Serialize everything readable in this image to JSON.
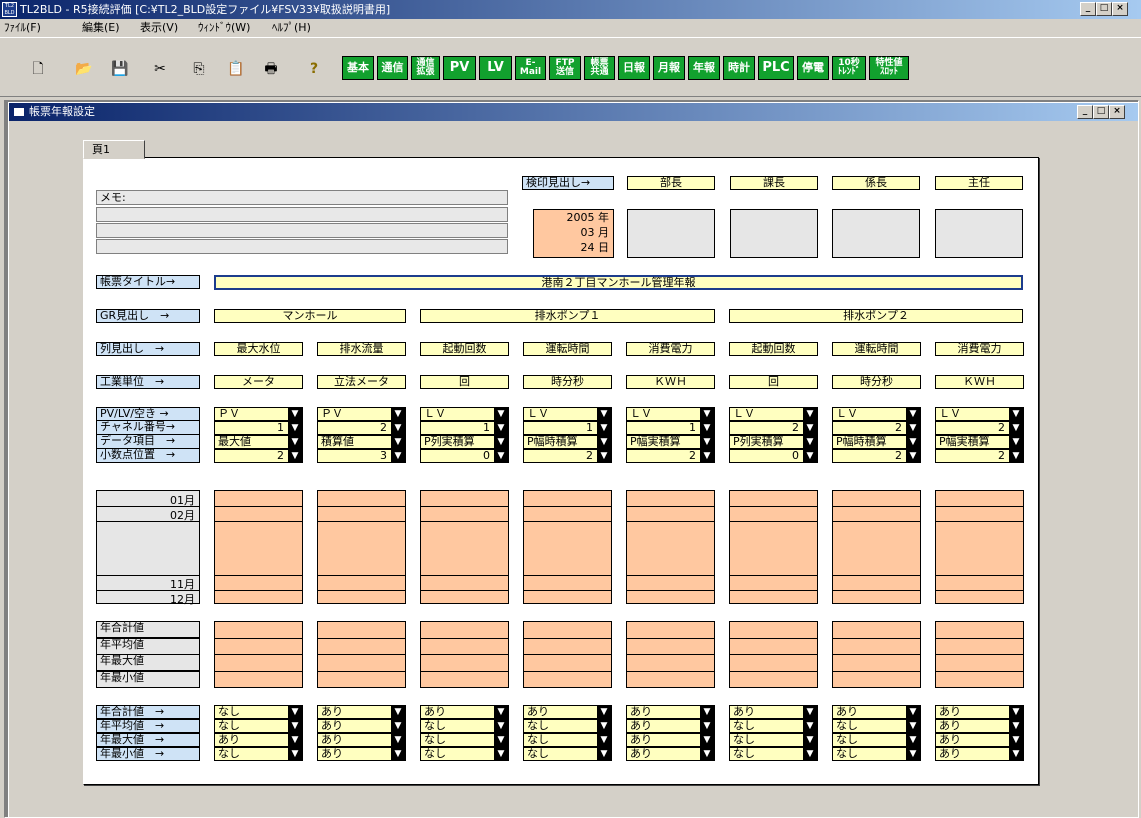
{
  "window": {
    "title": "TL2BLD - R5接続評価 [C:¥TL2_BLD設定ファイル¥FSV33¥取扱説明書用]",
    "app_icon": "TL2 BLD"
  },
  "menu": [
    "ﾌｧｲﾙ(F)",
    "編集(E)",
    "表示(V)",
    "ｳｨﾝﾄﾞｳ(W)",
    "ﾍﾙﾌﾟ(H)"
  ],
  "toolbar": {
    "icons": [
      "new-file-icon",
      "open-folder-icon",
      "save-icon",
      "cut-icon",
      "copy-icon",
      "paste-icon",
      "print-icon",
      "help-icon"
    ],
    "icon_glyphs": [
      "🗋",
      "📂",
      "💾",
      "✂",
      "⎘",
      "📋",
      "🖶",
      "?"
    ],
    "buttons": [
      "基本",
      "通信",
      "通信\n拡張",
      "PV",
      "LV",
      "E-\nMail",
      "FTP\n送信",
      "帳票\n共通",
      "日報",
      "月報",
      "年報",
      "時計",
      "PLC",
      "停電",
      "10秒\nﾄﾚﾝﾄﾞ",
      "特性値\nｽﾛｯﾄ"
    ]
  },
  "child": {
    "title": "帳票年報設定",
    "tab": "頁1"
  },
  "stamp": {
    "label": "検印見出し→",
    "titles": [
      "部長",
      "課長",
      "係長",
      "主任"
    ]
  },
  "memo": {
    "label": "メモ:"
  },
  "date": {
    "year": "2005 年",
    "month": "03 月",
    "day": "24 日"
  },
  "report_title": {
    "label": "帳票タイトル→",
    "value": "港南２丁目マンホール管理年報"
  },
  "group": {
    "label": "GR見出し　→",
    "values": [
      "マンホール",
      "排水ポンプ１",
      "排水ポンプ２"
    ]
  },
  "column": {
    "label": "列見出し　→",
    "values": [
      "最大水位",
      "排水流量",
      "起動回数",
      "運転時間",
      "消費電力",
      "起動回数",
      "運転時間",
      "消費電力"
    ]
  },
  "unit": {
    "label": "工業単位　→",
    "values": [
      "メータ",
      "立法メータ",
      "回",
      "時分秒",
      "ＫＷＨ",
      "回",
      "時分秒",
      "ＫＷＨ"
    ]
  },
  "config": {
    "labels": [
      "PV/LV/空き →",
      "チャネル番号→",
      "データ項目　→",
      "小数点位置　→"
    ],
    "pvlv": [
      "ＰＶ",
      "ＰＶ",
      "ＬＶ",
      "ＬＶ",
      "ＬＶ",
      "ＬＶ",
      "ＬＶ",
      "ＬＶ"
    ],
    "channel": [
      "1",
      "2",
      "1",
      "1",
      "1",
      "2",
      "2",
      "2"
    ],
    "item": [
      "最大値",
      "積算値",
      "P列実積算",
      "P幅時積算",
      "P幅実積算",
      "P列実積算",
      "P幅時積算",
      "P幅実積算"
    ],
    "decimal": [
      "2",
      "3",
      "0",
      "2",
      "2",
      "0",
      "2",
      "2"
    ]
  },
  "months": {
    "first": "01月",
    "second": "02月",
    "eleventh": "11月",
    "twelfth": "12月"
  },
  "summary": {
    "labels": [
      "年合計値",
      "年平均値",
      "年最大値",
      "年最小値"
    ]
  },
  "summary_sel": {
    "labels": [
      "年合計値　→",
      "年平均値　→",
      "年最大値　→",
      "年最小値　→"
    ],
    "rows": [
      [
        "なし",
        "あり",
        "あり",
        "あり",
        "あり",
        "あり",
        "あり",
        "あり"
      ],
      [
        "なし",
        "あり",
        "なし",
        "なし",
        "あり",
        "なし",
        "なし",
        "あり"
      ],
      [
        "あり",
        "あり",
        "なし",
        "なし",
        "あり",
        "なし",
        "なし",
        "あり"
      ],
      [
        "なし",
        "あり",
        "なし",
        "なし",
        "あり",
        "なし",
        "なし",
        "あり"
      ]
    ]
  },
  "dropdown_arrow": "▼",
  "colors": {
    "title_bar": "#0a246a",
    "green_button": "#12a12e",
    "label_blue": "#cfe3f6",
    "input_yellow": "#ffffc0",
    "cell_orange": "#ffc8a0"
  }
}
